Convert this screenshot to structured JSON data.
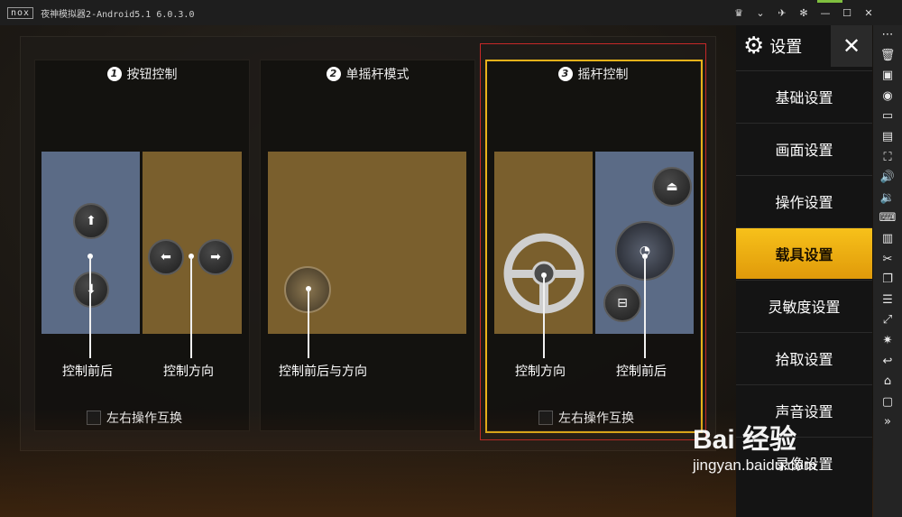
{
  "window": {
    "logo": "nox",
    "title": "夜神模拟器2-Android5.1 6.0.3.0"
  },
  "cards": [
    {
      "num": "1",
      "title": "按钮控制",
      "labels": [
        "控制前后",
        "控制方向"
      ],
      "checkbox": "左右操作互换"
    },
    {
      "num": "2",
      "title": "单摇杆模式",
      "labels": [
        "控制前后与方向"
      ]
    },
    {
      "num": "3",
      "title": "摇杆控制",
      "labels": [
        "控制方向",
        "控制前后"
      ],
      "checkbox": "左右操作互换"
    }
  ],
  "settings": {
    "title": "设置",
    "items": [
      "基础设置",
      "画面设置",
      "操作设置",
      "载具设置",
      "灵敏度设置",
      "拾取设置",
      "声音设置",
      "录像设置"
    ],
    "active_index": 3
  },
  "watermark": {
    "logo": "Bai 经验",
    "url": "jingyan.baidu.com"
  },
  "colors": {
    "accent": "#e8b21a",
    "blue_zone": "#5b6b86",
    "gold_zone": "#7a5f2d"
  }
}
